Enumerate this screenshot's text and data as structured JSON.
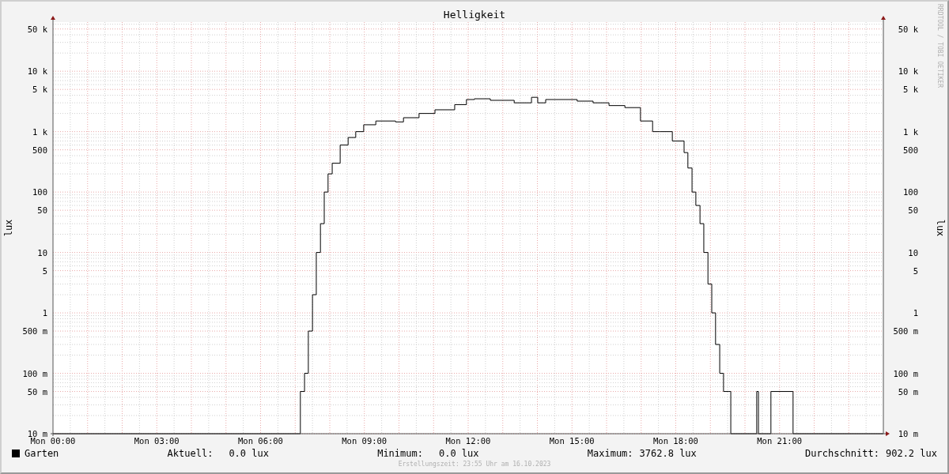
{
  "graph": {
    "title": "Helligkeit",
    "watermark": "RRDTOOL / TOBI OETIKER",
    "ylabel": "lux",
    "right_ylabel": "lux",
    "y_tick_labels": [
      "50 k",
      "10 k",
      "5 k",
      "1 k",
      "500",
      "100",
      "50",
      "10",
      "5",
      "1",
      "500 m",
      "100 m",
      "50 m",
      "10 m"
    ],
    "right_y_tick_labels": [
      "50 k",
      "10 k",
      "5 k",
      "1 k",
      "500",
      "100",
      "50",
      "10",
      "5",
      "1",
      "500 m",
      "100 m",
      "50 m",
      "10 m"
    ],
    "x_tick_labels": [
      "Mon 00:00",
      "Mon 03:00",
      "Mon 06:00",
      "Mon 09:00",
      "Mon 12:00",
      "Mon 15:00",
      "Mon 18:00",
      "Mon 21:00"
    ]
  },
  "legend": {
    "series": "Garten",
    "color": "#000000",
    "stats": [
      {
        "label": "Aktuell:",
        "value": "0.0 lux"
      },
      {
        "label": "Minimum:",
        "value": "0.0 lux"
      },
      {
        "label": "Maximum:",
        "value": "3762.8 lux"
      },
      {
        "label": "Durchschnitt:",
        "value": "902.2 lux"
      }
    ]
  },
  "footer": "Erstellungszeit: 23:55 Uhr am 16.10.2023"
}
